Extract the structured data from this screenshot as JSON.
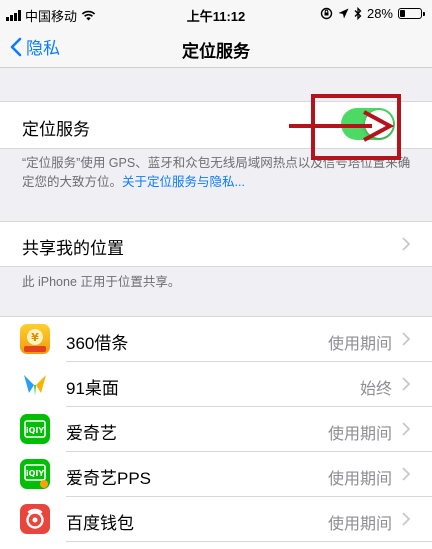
{
  "status_bar": {
    "carrier": "中国移动",
    "time": "上午11:12",
    "battery": "28%",
    "battery_level": 0.28
  },
  "nav": {
    "back_label": "隐私",
    "title": "定位服务"
  },
  "location_services": {
    "label": "定位服务",
    "enabled": true,
    "footer_text": "“定位服务”使用 GPS、蓝牙和众包无线局域网热点以及信号塔位置来确定您的大致方位。",
    "footer_link": "关于定位服务与隐私..."
  },
  "share_location": {
    "label": "共享我的位置",
    "footer_text": "此 iPhone 正用于位置共享。"
  },
  "apps": [
    {
      "name": "360借条",
      "value": "使用期间",
      "icon": "360-jietiao-icon"
    },
    {
      "name": "91桌面",
      "value": "始终",
      "icon": "91-desktop-icon"
    },
    {
      "name": "爱奇艺",
      "value": "使用期间",
      "icon": "iqiyi-icon"
    },
    {
      "name": "爱奇艺PPS",
      "value": "使用期间",
      "icon": "iqiyi-pps-icon"
    },
    {
      "name": "百度钱包",
      "value": "使用期间",
      "icon": "baidu-wallet-icon"
    }
  ],
  "colors": {
    "accent": "#0a7cff",
    "toggle_on": "#4cd964",
    "annotation": "#b3141c",
    "background": "#efeff4"
  }
}
